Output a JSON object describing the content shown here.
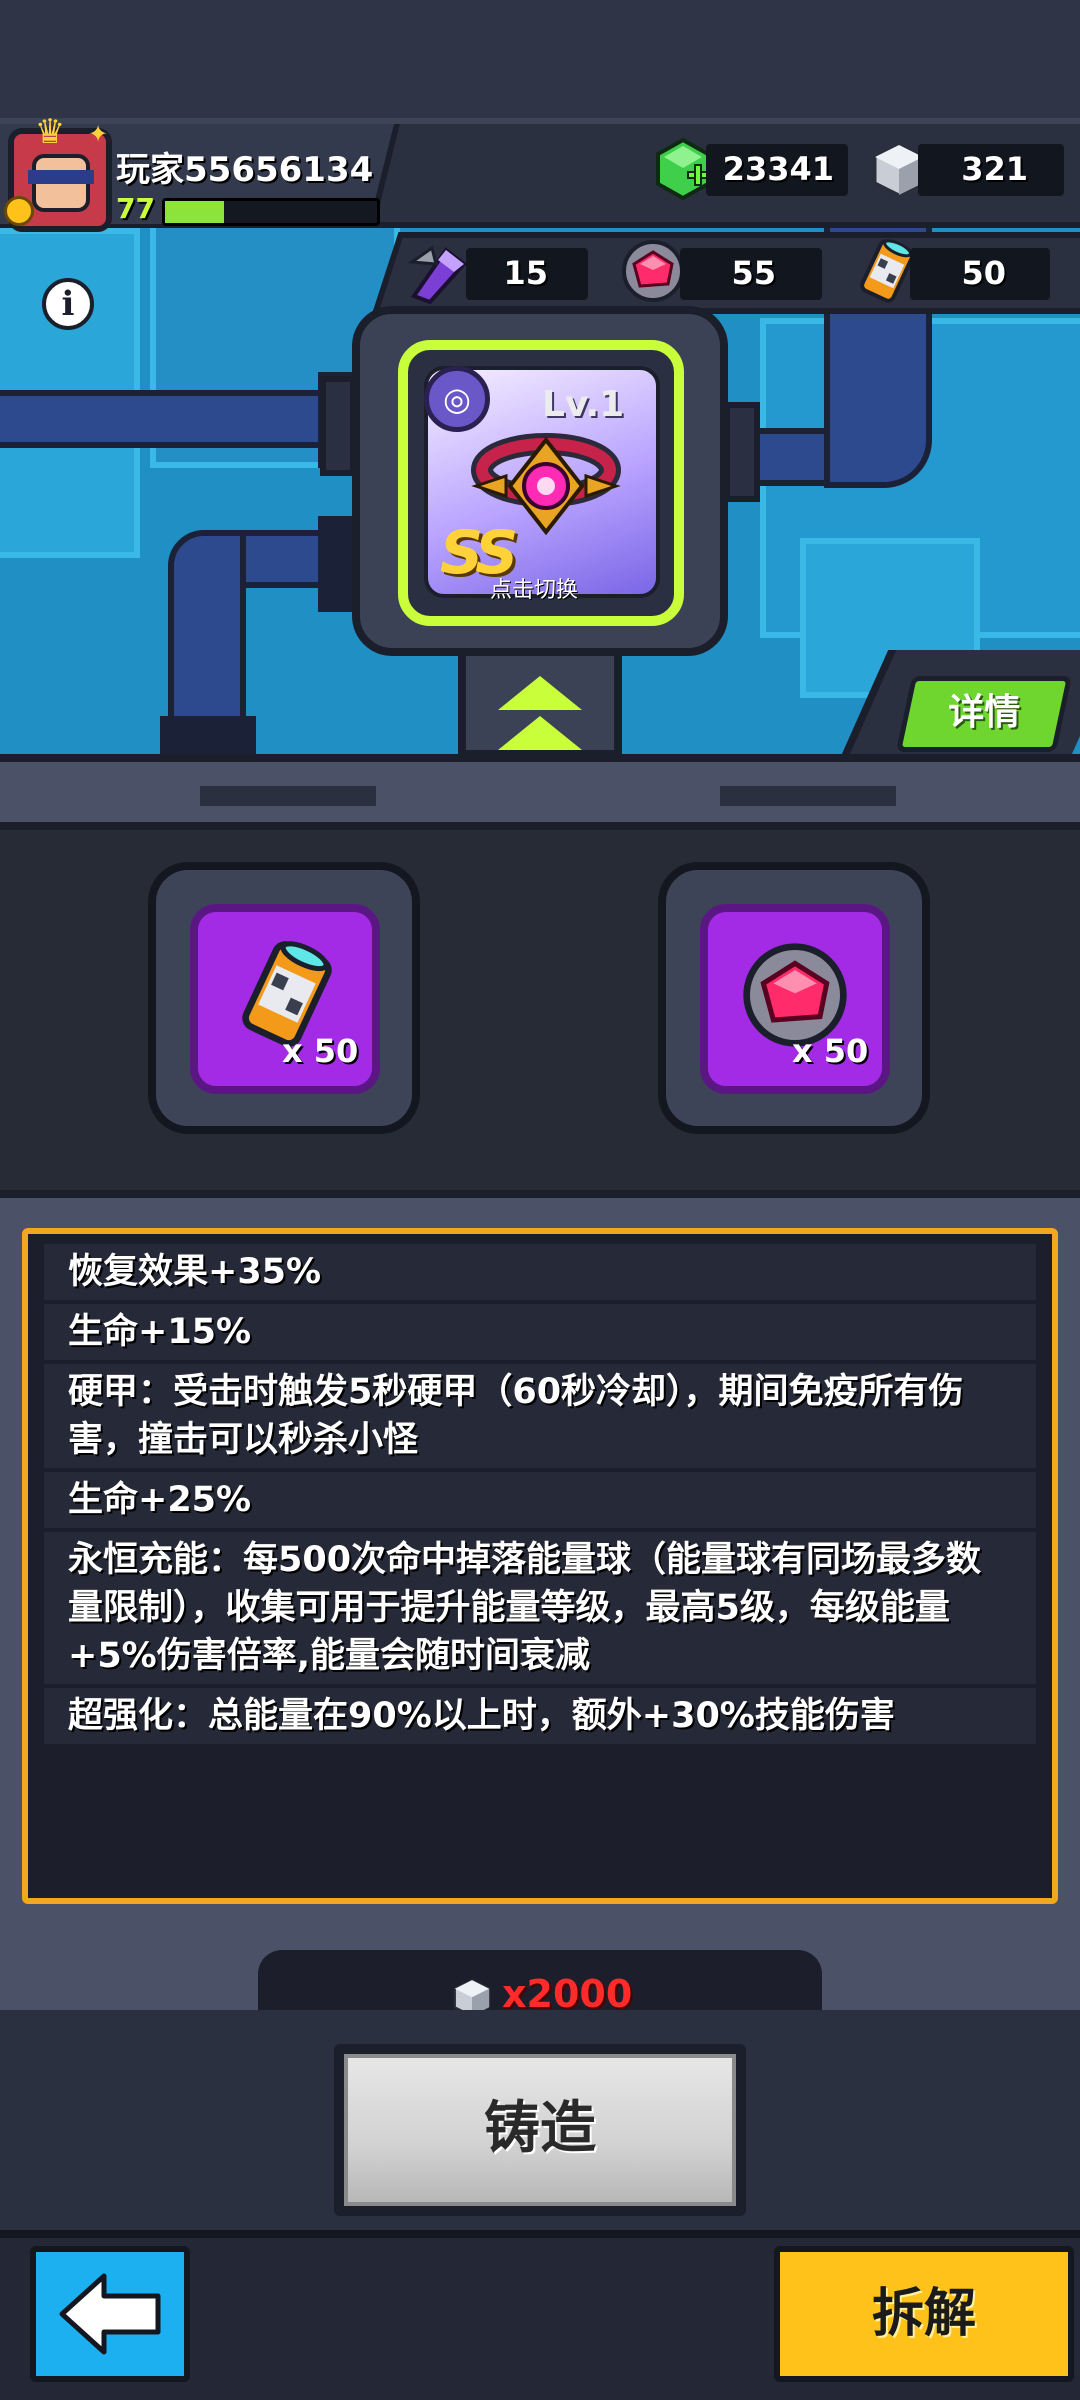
{
  "player": {
    "name": "玩家55656134",
    "level": "77",
    "xp_fraction": 0.28
  },
  "currencies": {
    "gems": "23341",
    "cubes": "321"
  },
  "resources": [
    {
      "icon": "purple-crystal-icon",
      "count": "15"
    },
    {
      "icon": "red-core-icon",
      "count": "55"
    },
    {
      "icon": "energy-canister-icon",
      "count": "50"
    }
  ],
  "equipment": {
    "level": "Lv.1",
    "grade": "SS",
    "tap_hint": "点击切换",
    "icon": "ring-equipment-icon"
  },
  "detail_button": "详情",
  "materials": [
    {
      "icon": "energy-canister-icon",
      "count": "x 50"
    },
    {
      "icon": "red-core-icon",
      "count": "x 50"
    }
  ],
  "effects": [
    "恢复效果+35%",
    "生命+15%",
    "硬甲：受击时触发5秒硬甲（60秒冷却），期间免疫所有伤害，撞击可以秒杀小怪",
    "生命+25%",
    "永恒充能：每500次命中掉落能量球（能量球有同场最多数量限制），收集可用于提升能量等级，最高5级，每级能量+5%伤害倍率,能量会随时间衰减",
    "超强化：总能量在90%以上时，额外+30%技能伤害"
  ],
  "cost": "x2000",
  "forge_button": "铸造",
  "dismantle_button": "拆解",
  "colors": {
    "accent_green": "#c8ff3a",
    "frame_gold": "#f0a81e",
    "material_purple": "#a42be6",
    "cost_red": "#ff2a2a"
  }
}
